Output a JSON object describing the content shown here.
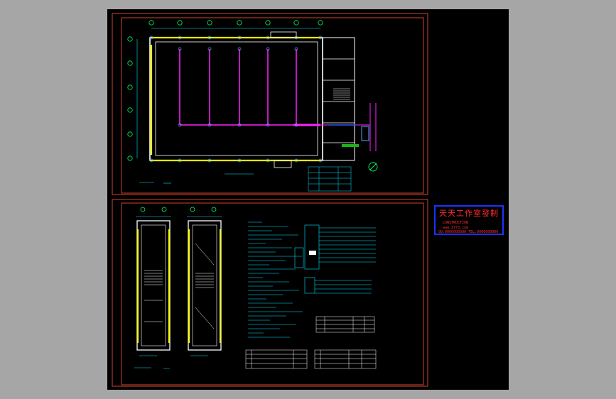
{
  "stamp": {
    "title": "天天工作室發制",
    "line1": "CONSTRUCTION",
    "line2": "www.3773.com",
    "line3": "QQ:0000000000 TEL:0000000000"
  },
  "colors": {
    "background": "#a6a6a6",
    "canvas": "#000000",
    "frame": "#d0432c",
    "wall": "#ffffff",
    "column": "#ffff00",
    "grid": "#00c8ff",
    "pipe": "#ff22ff",
    "text": "#00e5ff"
  }
}
